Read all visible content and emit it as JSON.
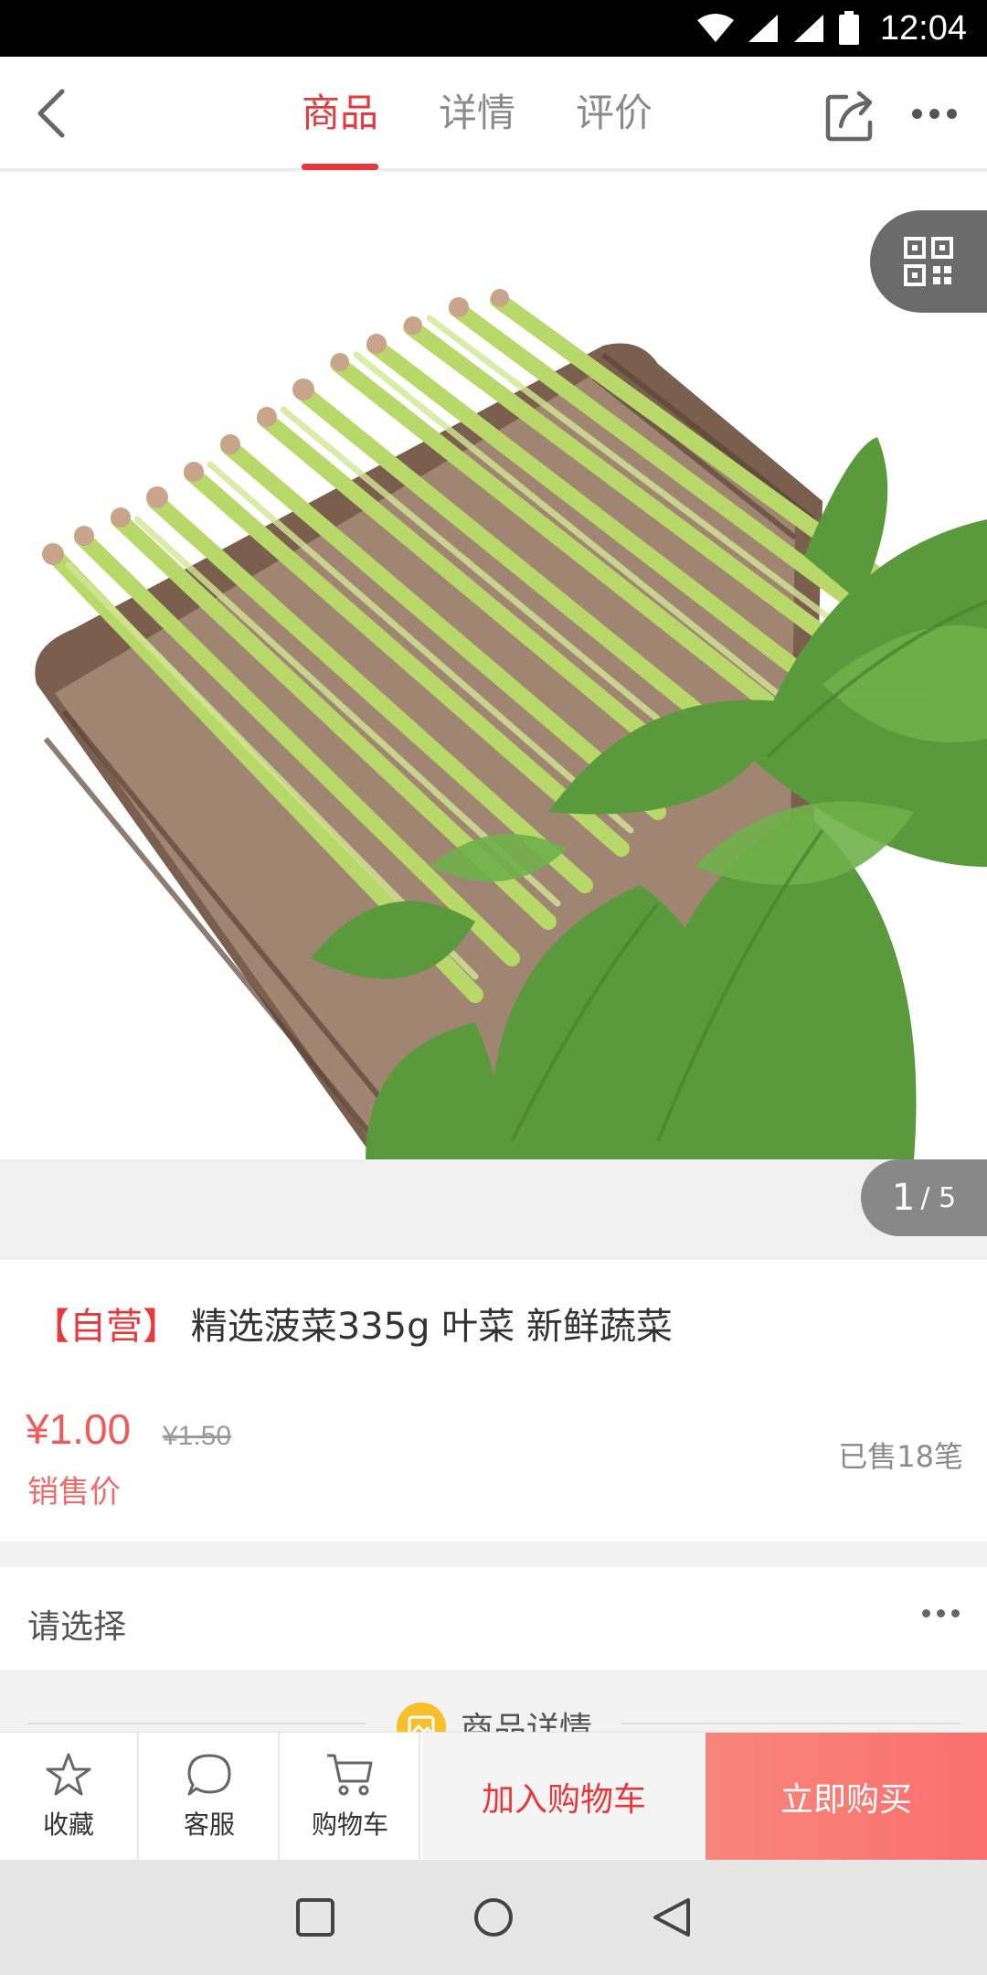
{
  "status_bar": {
    "time": "12:04"
  },
  "header": {
    "tabs": [
      {
        "label": "商品",
        "active": true
      },
      {
        "label": "详情",
        "active": false
      },
      {
        "label": "评价",
        "active": false
      }
    ]
  },
  "gallery": {
    "current": "1",
    "total": "/ 5"
  },
  "product": {
    "tag": "【自营】",
    "title": "精选菠菜335g 叶菜 新鲜蔬菜",
    "price": "¥1.00",
    "original_price": "¥1.50",
    "price_label": "销售价",
    "sold": "已售18笔"
  },
  "select_row": {
    "label": "请选择"
  },
  "detail_section": {
    "title": "商品详情"
  },
  "bottom_bar": {
    "favorite": "收藏",
    "service": "客服",
    "cart": "购物车",
    "add_to_cart": "加入购物车",
    "buy_now": "立即购买"
  },
  "colors": {
    "accent": "#e5393d",
    "price": "#ef5b5b",
    "buy_gradient": "#fb6f6f",
    "detail_icon": "#f5c02a"
  },
  "icons": [
    "wifi-icon",
    "signal-icon",
    "battery-icon",
    "back-icon",
    "share-icon",
    "more-icon",
    "qr-code-icon",
    "image-icon",
    "star-icon",
    "chat-icon",
    "cart-icon",
    "nav-square-icon",
    "nav-circle-icon",
    "nav-triangle-icon"
  ]
}
